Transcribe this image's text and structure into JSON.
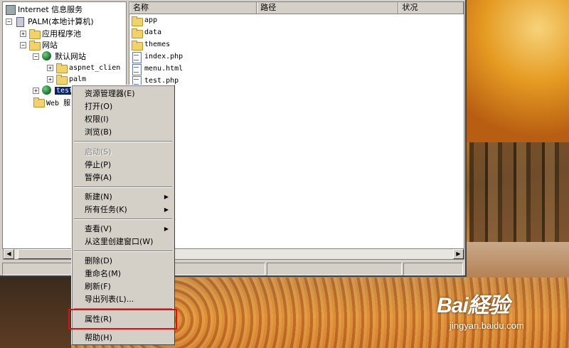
{
  "tree": {
    "root": "Internet 信息服务",
    "computer": "PALM(本地计算机)",
    "app_pools": "应用程序池",
    "websites": "网站",
    "default_site": "默认网站",
    "aspnet_client": "aspnet_clien",
    "palm": "palm",
    "selected_site": "test",
    "web_ext": "Web 服"
  },
  "list": {
    "columns": [
      "名称",
      "路径",
      "状况"
    ],
    "items": [
      "app",
      "data",
      "themes",
      "index.php",
      "menu.html",
      "test.php"
    ]
  },
  "context_menu": {
    "explorer": "资源管理器(E)",
    "open": "打开(O)",
    "permissions": "权限(I)",
    "browse": "浏览(B)",
    "start": "启动(S)",
    "stop": "停止(P)",
    "pause": "暂停(A)",
    "new": "新建(N)",
    "all_tasks": "所有任务(K)",
    "view": "查看(V)",
    "new_window": "从这里创建窗口(W)",
    "delete": "删除(D)",
    "rename": "重命名(M)",
    "refresh": "刷新(F)",
    "export": "导出列表(L)...",
    "properties": "属性(R)",
    "help": "帮助(H)"
  },
  "watermark": {
    "brand": "Bai経验",
    "url": "jingyan.baidu.com"
  },
  "colors": {
    "highlight": "#e01010",
    "selection": "#0a246a"
  }
}
